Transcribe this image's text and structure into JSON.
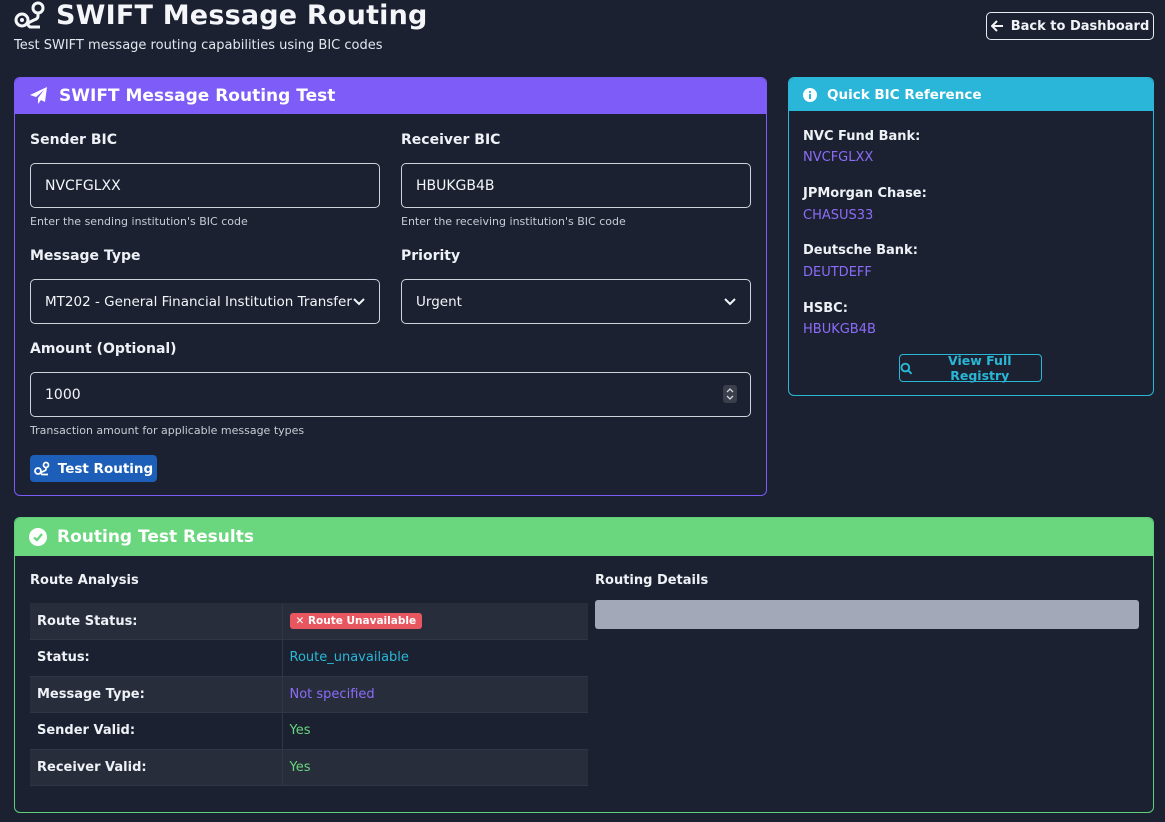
{
  "header": {
    "title": "SWIFT Message Routing",
    "subtitle": "Test SWIFT message routing capabilities using BIC codes",
    "back_label": "Back to Dashboard"
  },
  "form": {
    "title": "SWIFT Message Routing Test",
    "sender": {
      "label": "Sender BIC",
      "value": "NVCFGLXX",
      "hint": "Enter the sending institution's BIC code"
    },
    "receiver": {
      "label": "Receiver BIC",
      "value": "HBUKGB4B",
      "hint": "Enter the receiving institution's BIC code"
    },
    "message_type": {
      "label": "Message Type",
      "value": "MT202 - General Financial Institution Transfer"
    },
    "priority": {
      "label": "Priority",
      "value": "Urgent"
    },
    "amount": {
      "label": "Amount (Optional)",
      "value": "1000",
      "hint": "Transaction amount for applicable message types"
    },
    "submit_label": "Test Routing"
  },
  "bic_reference": {
    "title": "Quick BIC Reference",
    "entries": [
      {
        "name": "NVC Fund Bank:",
        "code": "NVCFGLXX"
      },
      {
        "name": "JPMorgan Chase:",
        "code": "CHASUS33"
      },
      {
        "name": "Deutsche Bank:",
        "code": "DEUTDEFF"
      },
      {
        "name": "HSBC:",
        "code": "HBUKGB4B"
      }
    ],
    "registry_label": "View Full Registry"
  },
  "results": {
    "title": "Routing Test Results",
    "route_analysis_title": "Route Analysis",
    "routing_details_title": "Routing Details",
    "rows": [
      {
        "label": "Route Status:",
        "value": "✕ Route Unavailable"
      },
      {
        "label": "Status:",
        "value": "Route_unavailable"
      },
      {
        "label": "Message Type:",
        "value": "Not specified"
      },
      {
        "label": "Sender Valid:",
        "value": "Yes"
      },
      {
        "label": "Receiver Valid:",
        "value": "Yes"
      }
    ]
  },
  "colors": {
    "form_accent": "#7d5cf7",
    "info_accent": "#29b6d9",
    "success_accent": "#6ad67d",
    "danger": "#e8565f",
    "background": "#1b2130"
  }
}
